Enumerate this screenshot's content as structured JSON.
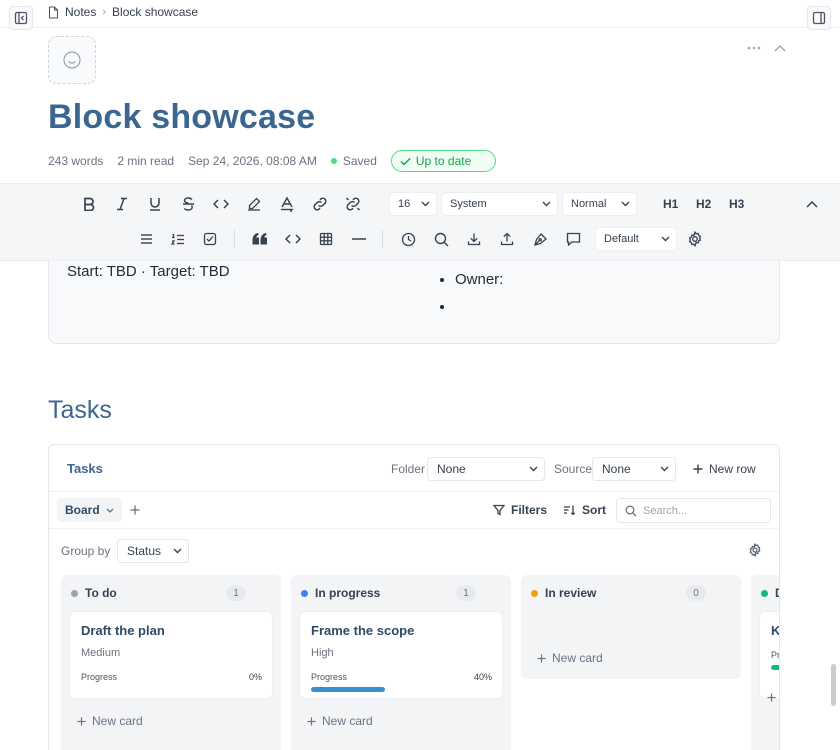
{
  "breadcrumb": {
    "root": "Notes",
    "current": "Block showcase"
  },
  "page": {
    "title": "Block showcase",
    "meta": {
      "words": "243 words",
      "read_time": "2 min read",
      "timestamp": "Sep 24, 2026, 08:08 AM",
      "saved": "Saved",
      "status": "Up to date"
    }
  },
  "toolbar": {
    "font_size": "16",
    "font_family": "System",
    "block_style": "Normal",
    "h1": "H1",
    "h2": "H2",
    "h3": "H3",
    "theme": "Default"
  },
  "info_block": {
    "dates": "Start: TBD · Target: TBD",
    "bullets": [
      "Owner:",
      ""
    ]
  },
  "tasks_heading": "Tasks",
  "database": {
    "title": "Tasks",
    "folder_label": "Folder",
    "folder_value": "None",
    "source_label": "Source",
    "source_value": "None",
    "new_row": "New row",
    "view": "Board",
    "filters": "Filters",
    "sort": "Sort",
    "search_placeholder": "Search...",
    "group_by_label": "Group by",
    "group_by_value": "Status",
    "columns": [
      {
        "name": "To do",
        "count": "1",
        "color": "#9ca3af",
        "card": {
          "title": "Draft the plan",
          "priority": "Medium",
          "progress_label": "Progress",
          "progress": "0%",
          "progress_value": 0
        },
        "new_card": "New card"
      },
      {
        "name": "In progress",
        "count": "1",
        "color": "#3b82f6",
        "card": {
          "title": "Frame the scope",
          "priority": "High",
          "progress_label": "Progress",
          "progress": "40%",
          "progress_value": 40
        },
        "new_card": "New card"
      },
      {
        "name": "In review",
        "count": "0",
        "color": "#f59e0b",
        "new_card": "New card"
      },
      {
        "name": "D",
        "color": "#10b981",
        "card": {
          "title": "K",
          "progress_label": "Pr"
        }
      }
    ]
  },
  "colors": {
    "accent": "#3b6690",
    "success": "#16a34a",
    "progress_blue": "#3b8fd0"
  }
}
